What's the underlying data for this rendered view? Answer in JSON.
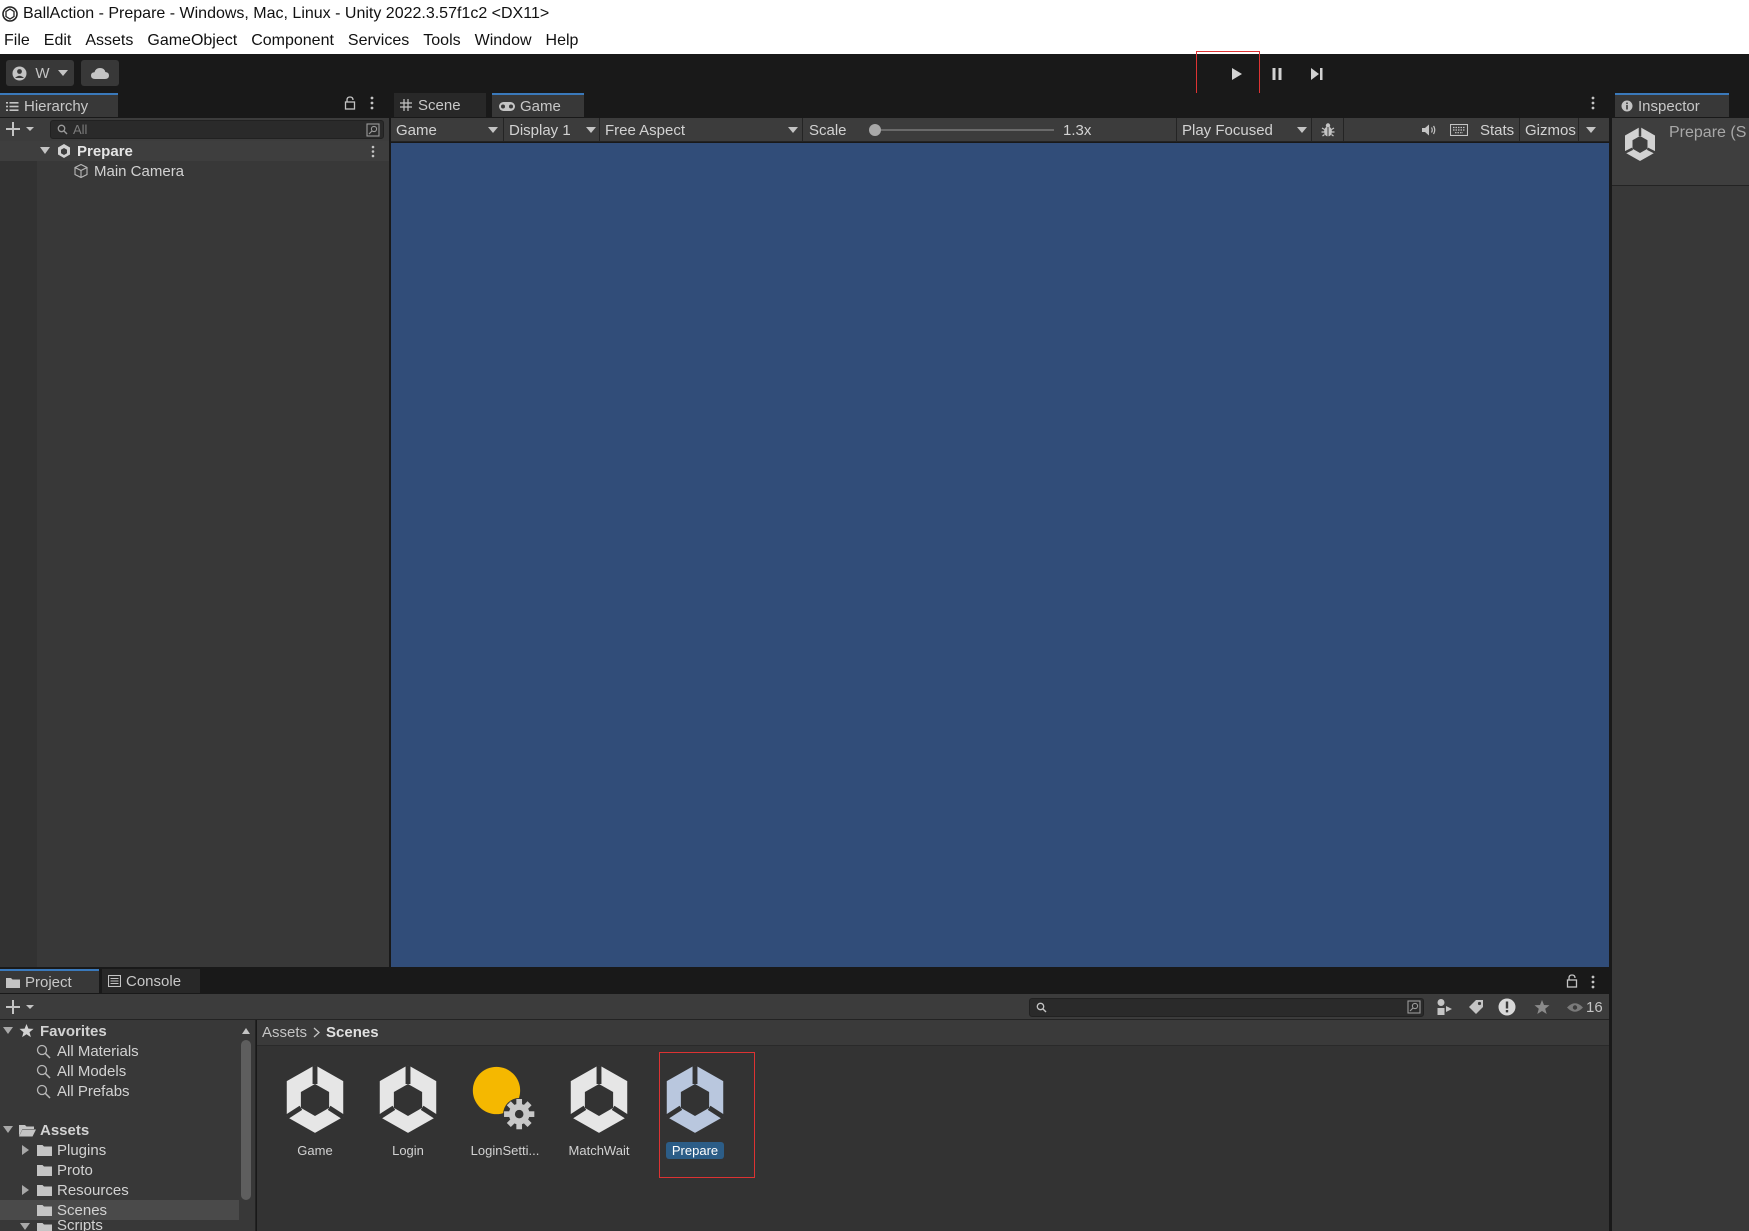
{
  "window": {
    "title": "BallAction - Prepare - Windows, Mac, Linux - Unity 2022.3.57f1c2 <DX11>"
  },
  "menu": [
    "File",
    "Edit",
    "Assets",
    "GameObject",
    "Component",
    "Services",
    "Tools",
    "Window",
    "Help"
  ],
  "toolbar": {
    "account_label": "W",
    "account_icon": "account-icon",
    "cloud_icon": "cloud-icon",
    "play_icon": "play-icon",
    "pause_icon": "pause-icon",
    "step_icon": "step-icon"
  },
  "hierarchy": {
    "tab_label": "Hierarchy",
    "search_placeholder": "All",
    "scene_name": "Prepare",
    "objects": [
      "Main Camera"
    ]
  },
  "center_tabs": {
    "scene_label": "Scene",
    "game_label": "Game"
  },
  "game_toolbar": {
    "view_select": "Game",
    "display_select": "Display 1",
    "aspect_select": "Free Aspect",
    "scale_label": "Scale",
    "scale_value": "1.3x",
    "scale_fraction": 0.0,
    "play_mode_select": "Play Focused",
    "stats_label": "Stats",
    "gizmos_label": "Gizmos"
  },
  "inspector": {
    "tab_label": "Inspector",
    "object_name": "Prepare (S"
  },
  "project": {
    "tab_label": "Project",
    "console_label": "Console",
    "hidden_count": "16",
    "favorites_label": "Favorites",
    "favorites": [
      "All Materials",
      "All Models",
      "All Prefabs"
    ],
    "assets_label": "Assets",
    "folders": [
      {
        "name": "Plugins",
        "expandable": true
      },
      {
        "name": "Proto",
        "expandable": false
      },
      {
        "name": "Resources",
        "expandable": true
      },
      {
        "name": "Scenes",
        "expandable": false
      },
      {
        "name": "Scripts",
        "expandable": true
      }
    ],
    "breadcrumb": {
      "root": "Assets",
      "current": "Scenes"
    },
    "assets": [
      {
        "name": "Game",
        "type": "scene"
      },
      {
        "name": "Login",
        "type": "scene"
      },
      {
        "name": "LoginSetti...",
        "type": "lighting-settings"
      },
      {
        "name": "MatchWait",
        "type": "scene"
      },
      {
        "name": "Prepare",
        "type": "scene",
        "selected": true
      }
    ]
  },
  "colors": {
    "game_background": "#314d79",
    "selection": "#2c5d87",
    "highlight_box": "#dd3333",
    "lighting_bulb": "#f5b800"
  }
}
